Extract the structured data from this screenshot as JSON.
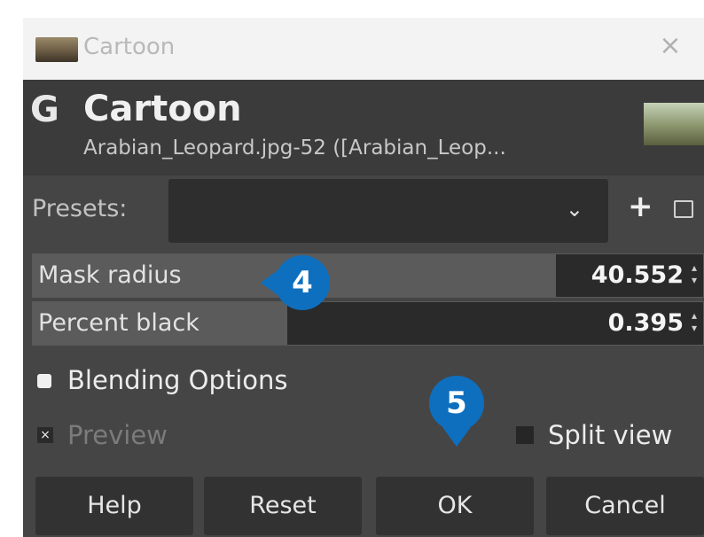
{
  "window": {
    "title": "Cartoon",
    "close_glyph": "×"
  },
  "header": {
    "logo_glyph": "G",
    "title": "Cartoon",
    "subtitle": "Arabian_Leopard.jpg-52 ([Arabian_Leop..."
  },
  "presets": {
    "label": "Presets:",
    "value": "",
    "chevron_glyph": "⌄",
    "add_glyph": "+"
  },
  "params": [
    {
      "label": "Mask radius",
      "value": "40.552",
      "fill_fraction": 0.78
    },
    {
      "label": "Percent black",
      "value": "0.395",
      "fill_fraction": 0.38
    }
  ],
  "blending": {
    "label": "Blending Options"
  },
  "preview": {
    "label": "Preview",
    "checked": true,
    "check_glyph": "×"
  },
  "split_view": {
    "label": "Split view",
    "checked": false
  },
  "buttons": {
    "help": "Help",
    "reset": "Reset",
    "ok": "OK",
    "cancel": "Cancel"
  },
  "callouts": {
    "step_a": "4",
    "step_b": "5"
  },
  "colors": {
    "callout": "#0e6fbf",
    "dialog_bg": "#454545"
  }
}
